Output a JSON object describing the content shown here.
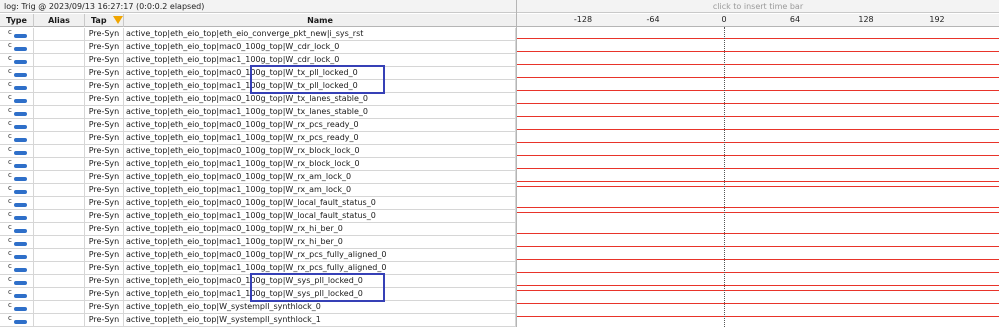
{
  "status_bar": {
    "trigger_text": "log: Trig @ 2023/09/13 16:27:17 (0:0:0.2 elapsed)",
    "insert_time_bar": "click to insert time bar"
  },
  "columns": {
    "type": "Type",
    "alias": "Alias",
    "tap": "Tap",
    "name": "Name"
  },
  "time_scale": {
    "ticks": [
      "-128",
      "-64",
      "0",
      "64",
      "128",
      "192"
    ]
  },
  "type_icon_letter": "c",
  "colors": {
    "waveform": "#e8342a",
    "highlight": "#3640b6",
    "type_icon": "#2e6fc9",
    "filter_icon": "#f0a500"
  },
  "rows": [
    {
      "tap": "Pre-Syn",
      "name": "active_top|eth_eio_top|eth_eio_converge_pkt_new|i_sys_rst",
      "waveform": "low"
    },
    {
      "tap": "Pre-Syn",
      "name": "active_top|eth_eio_top|mac0_100g_top|W_cdr_lock_0",
      "waveform": "low"
    },
    {
      "tap": "Pre-Syn",
      "name": "active_top|eth_eio_top|mac1_100g_top|W_cdr_lock_0",
      "waveform": "low"
    },
    {
      "tap": "Pre-Syn",
      "name": "active_top|eth_eio_top|mac0_100g_top|W_tx_pll_locked_0",
      "waveform": "low"
    },
    {
      "tap": "Pre-Syn",
      "name": "active_top|eth_eio_top|mac1_100g_top|W_tx_pll_locked_0",
      "waveform": "low"
    },
    {
      "tap": "Pre-Syn",
      "name": "active_top|eth_eio_top|mac0_100g_top|W_tx_lanes_stable_0",
      "waveform": "low"
    },
    {
      "tap": "Pre-Syn",
      "name": "active_top|eth_eio_top|mac1_100g_top|W_tx_lanes_stable_0",
      "waveform": "low"
    },
    {
      "tap": "Pre-Syn",
      "name": "active_top|eth_eio_top|mac0_100g_top|W_rx_pcs_ready_0",
      "waveform": "low"
    },
    {
      "tap": "Pre-Syn",
      "name": "active_top|eth_eio_top|mac1_100g_top|W_rx_pcs_ready_0",
      "waveform": "low"
    },
    {
      "tap": "Pre-Syn",
      "name": "active_top|eth_eio_top|mac0_100g_top|W_rx_block_lock_0",
      "waveform": "low"
    },
    {
      "tap": "Pre-Syn",
      "name": "active_top|eth_eio_top|mac1_100g_top|W_rx_block_lock_0",
      "waveform": "low"
    },
    {
      "tap": "Pre-Syn",
      "name": "active_top|eth_eio_top|mac0_100g_top|W_rx_am_lock_0",
      "waveform": "low"
    },
    {
      "tap": "Pre-Syn",
      "name": "active_top|eth_eio_top|mac1_100g_top|W_rx_am_lock_0",
      "waveform": "high"
    },
    {
      "tap": "Pre-Syn",
      "name": "active_top|eth_eio_top|mac0_100g_top|W_local_fault_status_0",
      "waveform": "low"
    },
    {
      "tap": "Pre-Syn",
      "name": "active_top|eth_eio_top|mac1_100g_top|W_local_fault_status_0",
      "waveform": "high"
    },
    {
      "tap": "Pre-Syn",
      "name": "active_top|eth_eio_top|mac0_100g_top|W_rx_hi_ber_0",
      "waveform": "low"
    },
    {
      "tap": "Pre-Syn",
      "name": "active_top|eth_eio_top|mac1_100g_top|W_rx_hi_ber_0",
      "waveform": "low"
    },
    {
      "tap": "Pre-Syn",
      "name": "active_top|eth_eio_top|mac0_100g_top|W_rx_pcs_fully_aligned_0",
      "waveform": "low"
    },
    {
      "tap": "Pre-Syn",
      "name": "active_top|eth_eio_top|mac1_100g_top|W_rx_pcs_fully_aligned_0",
      "waveform": "low"
    },
    {
      "tap": "Pre-Syn",
      "name": "active_top|eth_eio_top|mac0_100g_top|W_sys_pll_locked_0",
      "waveform": "low"
    },
    {
      "tap": "Pre-Syn",
      "name": "active_top|eth_eio_top|mac1_100g_top|W_sys_pll_locked_0",
      "waveform": "high"
    },
    {
      "tap": "Pre-Syn",
      "name": "active_top|eth_eio_top|W_systempll_synthlock_0",
      "waveform": "high"
    },
    {
      "tap": "Pre-Syn",
      "name": "active_top|eth_eio_top|W_systempll_synthlock_1",
      "waveform": "high"
    }
  ],
  "highlighted_rows": [
    [
      3,
      4
    ],
    [
      19,
      20
    ]
  ]
}
